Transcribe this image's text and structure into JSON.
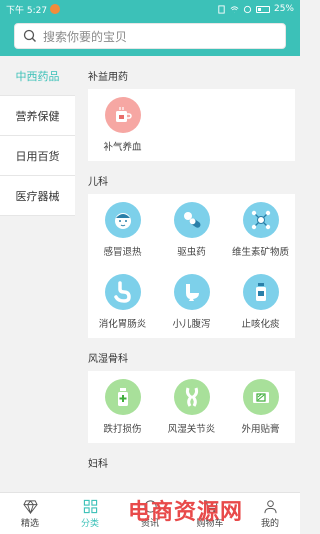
{
  "status_bar": {
    "time": "下午 5:27",
    "battery": "25%"
  },
  "search": {
    "placeholder": "搜索你要的宝贝"
  },
  "sidebar": {
    "items": [
      {
        "label": "中西药品",
        "active": true
      },
      {
        "label": "营养保健",
        "active": false
      },
      {
        "label": "日用百货",
        "active": false
      },
      {
        "label": "医疗器械",
        "active": false
      }
    ]
  },
  "sections": [
    {
      "title": "补益用药",
      "items": [
        {
          "label": "补气养血",
          "icon": "tea-cup-icon"
        }
      ]
    },
    {
      "title": "儿科",
      "items": [
        {
          "label": "感冒退热",
          "icon": "child-face-icon"
        },
        {
          "label": "驱虫药",
          "icon": "pill-icon"
        },
        {
          "label": "维生素矿物质",
          "icon": "molecule-icon"
        },
        {
          "label": "消化胃肠炎",
          "icon": "stomach-icon"
        },
        {
          "label": "小儿腹泻",
          "icon": "toilet-icon"
        },
        {
          "label": "止咳化痰",
          "icon": "medicine-bottle-icon"
        }
      ]
    },
    {
      "title": "风湿骨科",
      "items": [
        {
          "label": "跌打损伤",
          "icon": "ointment-bottle-icon"
        },
        {
          "label": "风湿关节炎",
          "icon": "bone-joint-icon"
        },
        {
          "label": "外用贴膏",
          "icon": "plaster-icon"
        }
      ]
    },
    {
      "title": "妇科",
      "items": []
    }
  ],
  "bottom_nav": {
    "items": [
      {
        "label": "精选",
        "icon": "diamond-icon"
      },
      {
        "label": "分类",
        "icon": "grid-icon",
        "active": true
      },
      {
        "label": "资讯",
        "icon": "news-icon"
      },
      {
        "label": "购物车",
        "icon": "cart-icon"
      },
      {
        "label": "我的",
        "icon": "user-icon"
      }
    ]
  },
  "watermark": "电商资源网",
  "colors": {
    "accent": "#3cc1b8",
    "icon_red": "#f6a7a3",
    "icon_blue": "#7dd0ea",
    "icon_green": "#a8e09a"
  }
}
